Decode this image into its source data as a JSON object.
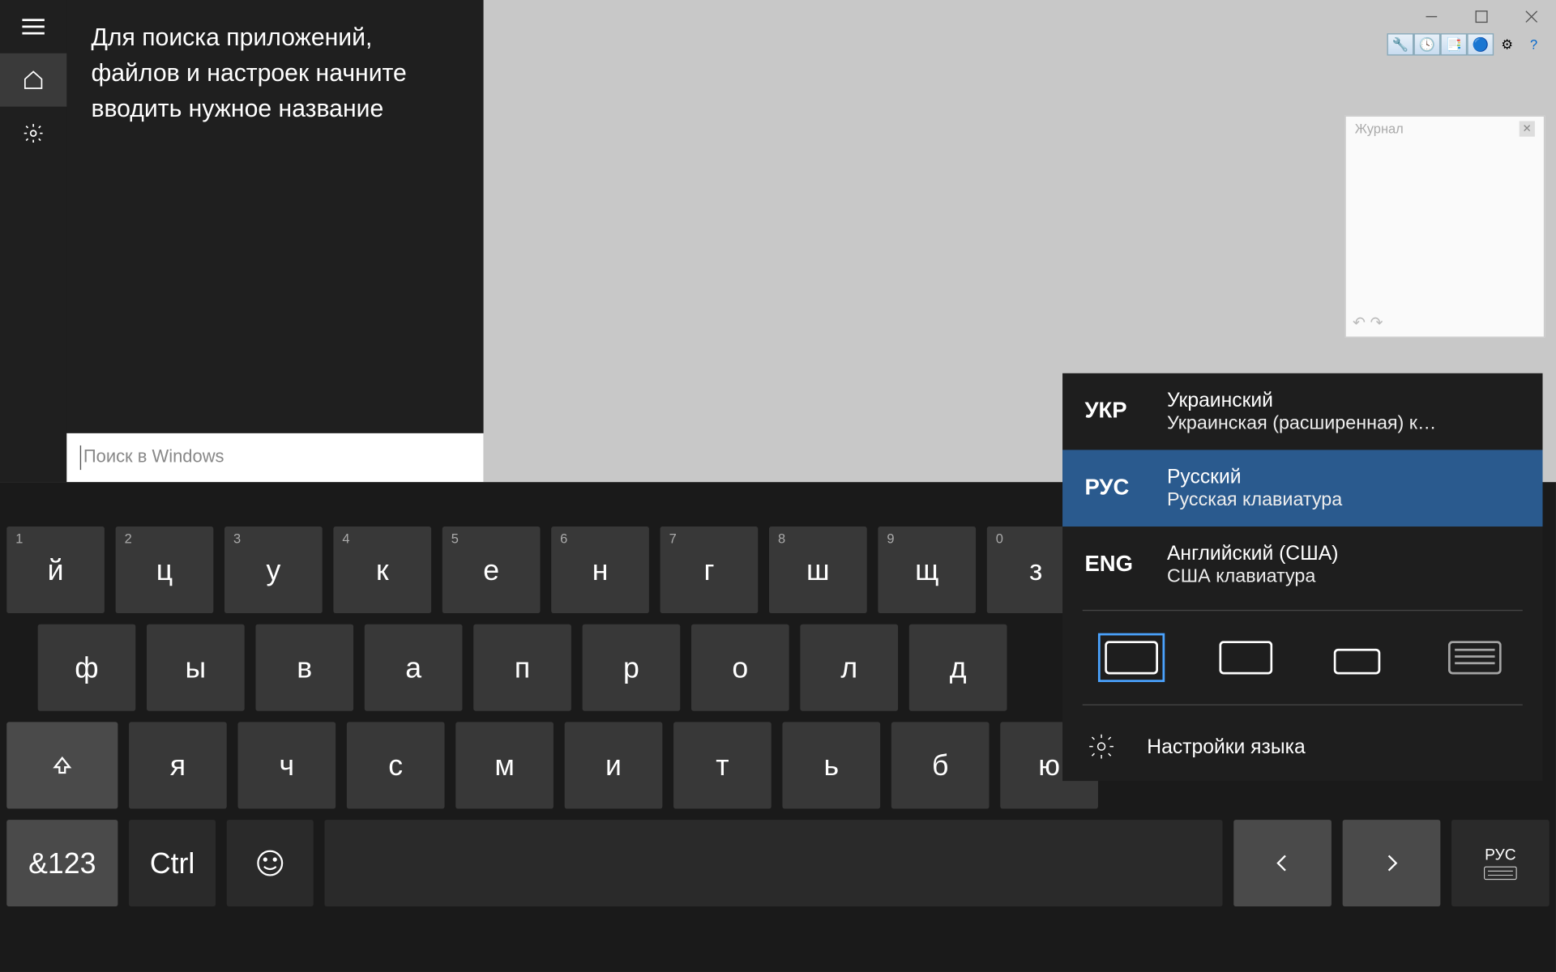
{
  "window": {
    "minimize": "—",
    "maximize": "❐",
    "close": "✕"
  },
  "toolbar": {
    "icons": [
      "🔧",
      "🕐",
      "📁",
      "🎨",
      "⚙",
      "❓"
    ]
  },
  "history": {
    "title": "Журнал",
    "undo": "↶",
    "redo": "↷"
  },
  "search": {
    "hint": "Для поиска приложений, файлов и настроек начните вводить нужное название",
    "placeholder": "Поиск в Windows"
  },
  "keyboard": {
    "row1": [
      {
        "n": "1",
        "c": "й"
      },
      {
        "n": "2",
        "c": "ц"
      },
      {
        "n": "3",
        "c": "у"
      },
      {
        "n": "4",
        "c": "к"
      },
      {
        "n": "5",
        "c": "е"
      },
      {
        "n": "6",
        "c": "н"
      },
      {
        "n": "7",
        "c": "г"
      },
      {
        "n": "8",
        "c": "ш"
      },
      {
        "n": "9",
        "c": "щ"
      },
      {
        "n": "0",
        "c": "з"
      }
    ],
    "row2": [
      "ф",
      "ы",
      "в",
      "а",
      "п",
      "р",
      "о",
      "л",
      "д"
    ],
    "row3": [
      "я",
      "ч",
      "с",
      "м",
      "и",
      "т",
      "ь",
      "б",
      "ю"
    ],
    "sym": "&123",
    "ctrl": "Ctrl",
    "langkey": "РУС"
  },
  "lang": {
    "items": [
      {
        "code": "УКР",
        "name": "Украинский",
        "sub": "Украинская (расширенная) к…",
        "sel": false
      },
      {
        "code": "РУС",
        "name": "Русский",
        "sub": "Русская клавиатура",
        "sel": true
      },
      {
        "code": "ENG",
        "name": "Английский (США)",
        "sub": "США клавиатура",
        "sel": false
      }
    ],
    "settings": "Настройки языка"
  }
}
